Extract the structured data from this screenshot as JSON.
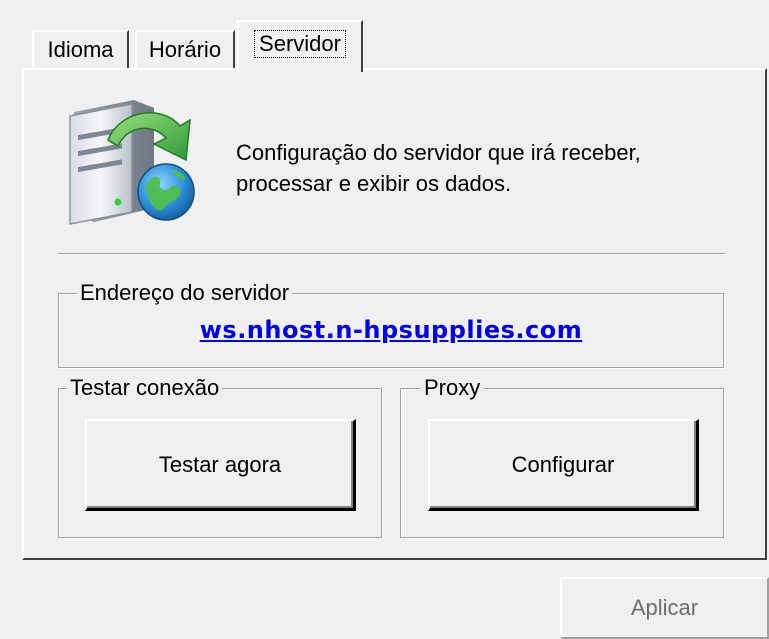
{
  "tabs": [
    {
      "label": "Idioma"
    },
    {
      "label": "Horário"
    },
    {
      "label": "Servidor"
    }
  ],
  "active_tab": "Servidor",
  "description": {
    "line1": "Configuração do servidor que irá receber,",
    "line2": "processar e exibir os dados."
  },
  "server_address": {
    "legend": "Endereço do servidor",
    "value": "ws.nhost.n-hpsupplies.com"
  },
  "test_connection": {
    "legend": "Testar conexão",
    "button_label": "Testar agora"
  },
  "proxy": {
    "legend": "Proxy",
    "button_label": "Configurar"
  },
  "apply_button": {
    "label": "Aplicar",
    "enabled": false
  },
  "icons": {
    "server_icon": "server-download-globe-icon"
  },
  "colors": {
    "window_bg": "#f0f0f0",
    "link": "#0000ee",
    "disabled_text": "#6d6d6d"
  }
}
